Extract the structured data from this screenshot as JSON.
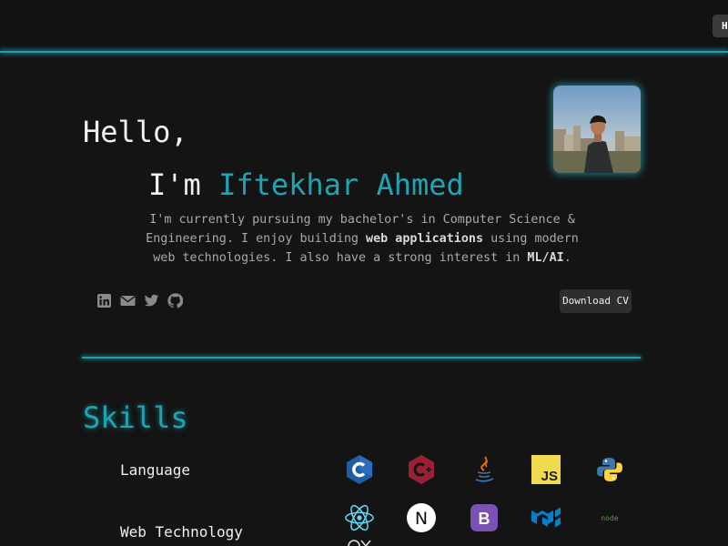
{
  "nav": {
    "button_label": "Home"
  },
  "hero": {
    "greeting": "Hello,",
    "intro_prefix": "I'm ",
    "name": "Iftekhar Ahmed",
    "bio": {
      "part1": "I'm currently pursuing my bachelor's in Computer Science & Engineering. I enjoy building ",
      "bold1": "web applications",
      "part2": " using modern web technologies. I also have a strong interest in ",
      "bold2": "ML/AI",
      "part3": "."
    },
    "download_cv_label": "Download CV"
  },
  "socials": [
    "linkedin-icon",
    "email-icon",
    "twitter-icon",
    "github-icon"
  ],
  "skills": {
    "title": "Skills",
    "categories": [
      {
        "label": "Language",
        "icons": [
          "c-icon",
          "cpp-icon",
          "java-icon",
          "javascript-icon",
          "python-icon"
        ]
      },
      {
        "label": "Web Technology",
        "icons": [
          "react-icon",
          "nextjs-icon",
          "bootstrap-icon",
          "material-ui-icon",
          "nodejs-icon"
        ]
      }
    ],
    "js_badge": "JS",
    "next_badge": "N",
    "bootstrap_badge": "B",
    "node_badge": "node"
  },
  "colors": {
    "accent": "#1fa4b3",
    "background": "#141414"
  }
}
